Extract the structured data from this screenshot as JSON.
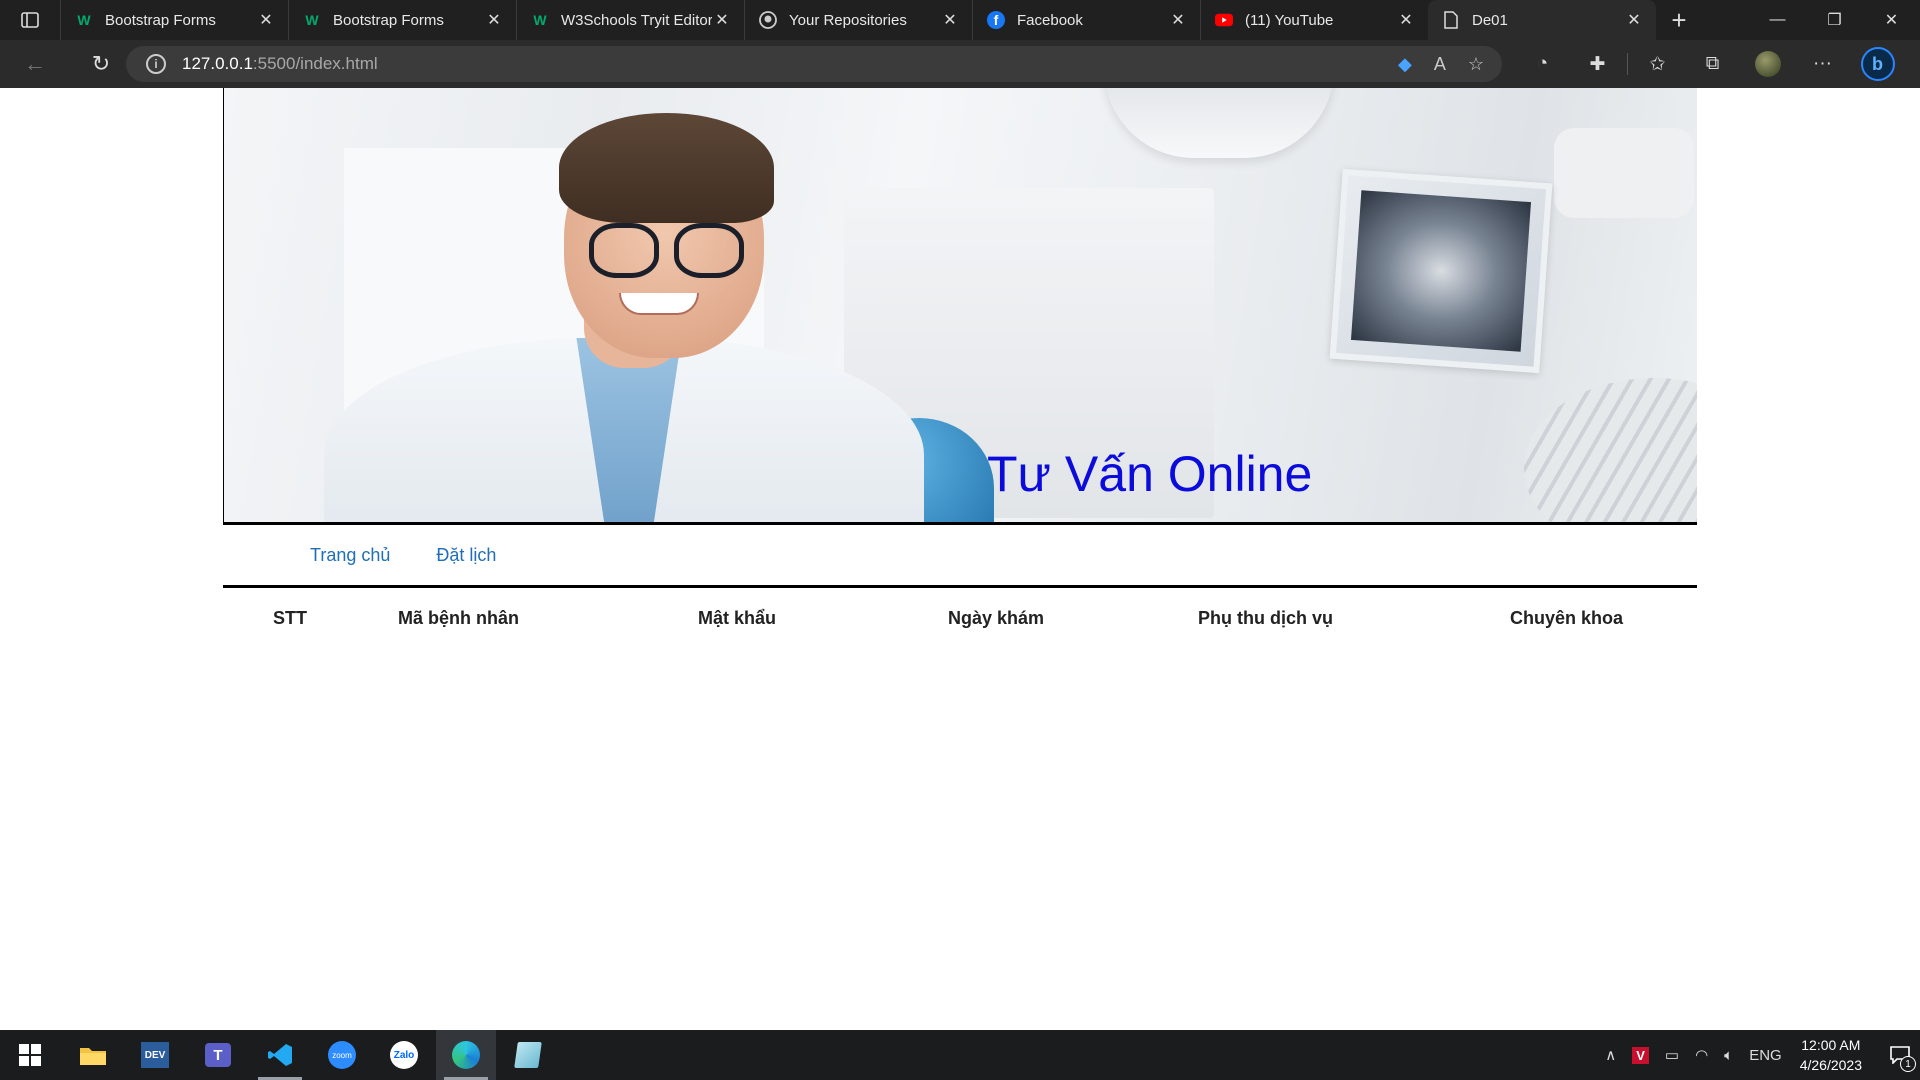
{
  "browser": {
    "tabs": [
      {
        "title": "Bootstrap Forms",
        "icon": "w3schools-icon"
      },
      {
        "title": "Bootstrap Forms",
        "icon": "w3schools-icon"
      },
      {
        "title": "W3Schools Tryit Editor",
        "icon": "w3schools-icon"
      },
      {
        "title": "Your Repositories",
        "icon": "github-icon"
      },
      {
        "title": "Facebook",
        "icon": "facebook-icon"
      },
      {
        "title": "(11) YouTube",
        "icon": "youtube-icon"
      },
      {
        "title": "De01",
        "icon": "document-icon",
        "active": true
      }
    ],
    "url_host": "127.0.0.1",
    "url_rest": ":5500/index.html"
  },
  "page": {
    "banner_title": "Tư Vấn Online",
    "menu": [
      "Trang chủ",
      "Đặt lịch"
    ],
    "table_headers": [
      "STT",
      "Mã bệnh nhân",
      "Mật khẩu",
      "Ngày khám",
      "Phụ thu dịch vụ",
      "Chuyên khoa"
    ]
  },
  "taskbar": {
    "apps": [
      "start",
      "file-explorer",
      "dev-cpp",
      "teams",
      "vscode",
      "zoom",
      "zalo",
      "edge",
      "notepad"
    ],
    "language": "ENG",
    "time": "12:00 AM",
    "date": "4/26/2023",
    "notification_count": "1"
  },
  "colors": {
    "banner_title": "#0b0bdc",
    "menu_link": "#1f6fb8",
    "tab_strip": "#202020",
    "toolbar": "#2b2b2b",
    "taskbar": "#1b1c1e"
  }
}
